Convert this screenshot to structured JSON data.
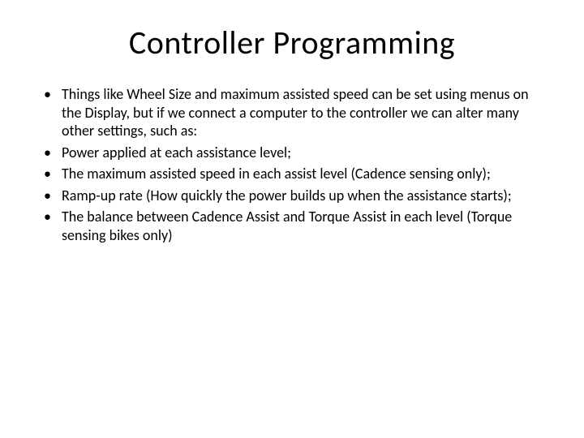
{
  "title": "Controller Programming",
  "bullets": [
    "Things like Wheel Size and maximum assisted speed can be set using menus on the Display, but if we connect a computer to the controller we can alter many other settings, such as:",
    "Power applied at each assistance level;",
    "The maximum assisted speed in each assist level (Cadence sensing only);",
    "Ramp-up rate (How quickly the power builds up when the assistance starts);",
    "The balance between Cadence Assist and Torque Assist in each level (Torque sensing bikes only)"
  ]
}
